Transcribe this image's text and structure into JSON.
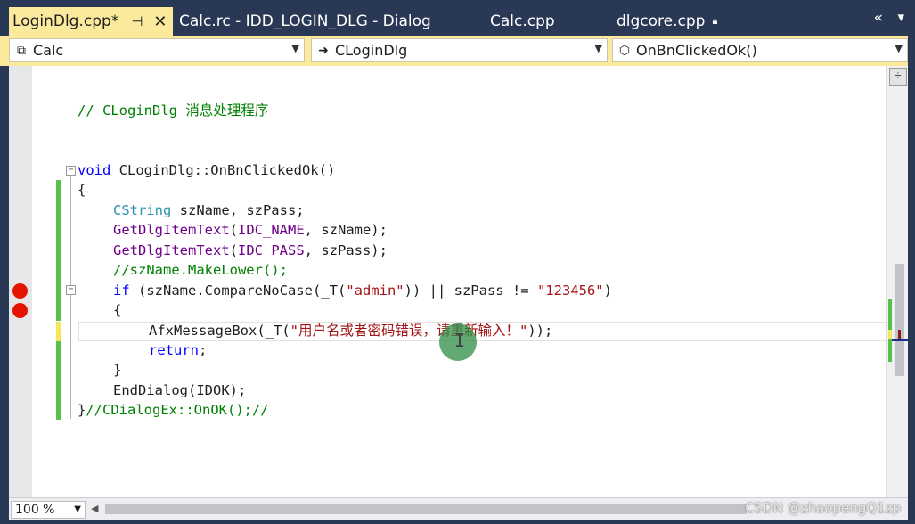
{
  "tabs": [
    {
      "label": "LoginDlg.cpp*",
      "active": true
    },
    {
      "label": "Calc.rc - IDD_LOGIN_DLG - Dialog"
    },
    {
      "label": "Calc.cpp"
    },
    {
      "label": "dlgcore.cpp"
    }
  ],
  "tab_icons": {
    "pin": "pin-icon",
    "close": "close-icon",
    "lock": "lock-icon",
    "overflow": "«",
    "dropdown": "▾"
  },
  "navigation": {
    "project": "Calc",
    "class": "CLoginDlg",
    "member": "OnBnClickedOk()",
    "class_prefix": "➜"
  },
  "code": {
    "comment_line": "// CLoginDlg 消息处理程序",
    "line1_kw": "void",
    "line1_rest": " CLoginDlg::OnBnClickedOk()",
    "open_brace": "{",
    "line3_type": "CString",
    "line3_rest": " szName, szPass;",
    "line4_func": "GetDlgItemText",
    "line4_macro": "IDC_NAME",
    "line4_rest": ", szName);",
    "line5_func": "GetDlgItemText",
    "line5_macro": "IDC_PASS",
    "line5_rest": ", szPass);",
    "line6_comment": "//szName.MakeLower();",
    "line7_kw": "if",
    "line7_a": " (szName.CompareNoCase(_T(",
    "line7_str1": "\"admin\"",
    "line7_b": ")) || szPass != ",
    "line7_str2": "\"123456\"",
    "line7_c": ")",
    "line8": "{",
    "line9_a": "AfxMessageBox(_T(",
    "line9_str": "\"用户名或者密码错误，请重新输入！\"",
    "line9_b": "));",
    "line10_kw": "return",
    "line10_rest": ";",
    "line11": "}",
    "line12": "EndDialog(IDOK);",
    "line13_a": "}",
    "line13_comment": "//CDialogEx::OnOK();//"
  },
  "status": {
    "zoom": "100 %",
    "watermark": "CSDN @zhaopengQ1zp"
  },
  "colors": {
    "tab_bar": "#293955",
    "active_tab": "#fbe99c",
    "keyword": "#0000ff",
    "comment": "#008000",
    "type": "#2b91af",
    "string": "#a31515",
    "macro": "#6f008a",
    "breakpoint": "#e51400",
    "change_saved": "#57c24a",
    "change_unsaved": "#f6e45a"
  }
}
